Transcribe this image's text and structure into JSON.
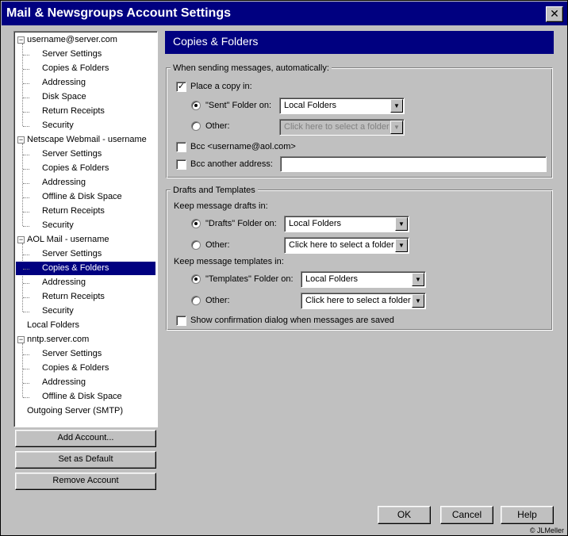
{
  "window": {
    "title": "Mail & Newsgroups Account Settings",
    "close_label": "✕"
  },
  "tree": [
    {
      "label": "username@server.com",
      "level": 0,
      "expander": "−"
    },
    {
      "label": "Server Settings",
      "level": 1
    },
    {
      "label": "Copies & Folders",
      "level": 1
    },
    {
      "label": "Addressing",
      "level": 1
    },
    {
      "label": "Disk Space",
      "level": 1
    },
    {
      "label": "Return Receipts",
      "level": 1
    },
    {
      "label": "Security",
      "level": 1
    },
    {
      "label": "Netscape Webmail - username",
      "level": 0,
      "expander": "−"
    },
    {
      "label": "Server Settings",
      "level": 1
    },
    {
      "label": "Copies & Folders",
      "level": 1
    },
    {
      "label": "Addressing",
      "level": 1
    },
    {
      "label": "Offline & Disk Space",
      "level": 1
    },
    {
      "label": "Return Receipts",
      "level": 1
    },
    {
      "label": "Security",
      "level": 1
    },
    {
      "label": "AOL Mail - username",
      "level": 0,
      "expander": "−"
    },
    {
      "label": "Server Settings",
      "level": 1
    },
    {
      "label": "Copies & Folders",
      "level": 1,
      "selected": true
    },
    {
      "label": "Addressing",
      "level": 1
    },
    {
      "label": "Return Receipts",
      "level": 1
    },
    {
      "label": "Security",
      "level": 1
    },
    {
      "label": "Local Folders",
      "level": 0
    },
    {
      "label": "nntp.server.com",
      "level": 0,
      "expander": "−"
    },
    {
      "label": "Server Settings",
      "level": 1
    },
    {
      "label": "Copies & Folders",
      "level": 1
    },
    {
      "label": "Addressing",
      "level": 1
    },
    {
      "label": "Offline & Disk Space",
      "level": 1
    },
    {
      "label": "Outgoing Server (SMTP)",
      "level": 0
    }
  ],
  "left_buttons": {
    "add": "Add Account...",
    "default": "Set as Default",
    "remove": "Remove Account"
  },
  "panel": {
    "title": "Copies & Folders",
    "sending": {
      "group_title": "When sending messages, automatically:",
      "place_copy": {
        "label": "Place a copy in:",
        "checked": true
      },
      "sent_folder": {
        "label": "\"Sent\" Folder on:",
        "selected": true,
        "value": "Local Folders"
      },
      "other": {
        "label": "Other:",
        "selected": false,
        "value": "Click here to select a folder"
      },
      "bcc_self": {
        "label": "Bcc <username@aol.com>",
        "checked": false
      },
      "bcc_other": {
        "label": "Bcc another address:",
        "checked": false,
        "value": ""
      }
    },
    "drafts": {
      "group_title": "Drafts and Templates",
      "keep_drafts": "Keep message drafts in:",
      "drafts_folder": {
        "label": "\"Drafts\" Folder on:",
        "selected": true,
        "value": "Local Folders"
      },
      "drafts_other": {
        "label": "Other:",
        "selected": false,
        "value": "Click here to select a folder"
      },
      "keep_templates": "Keep message templates in:",
      "templates_folder": {
        "label": "\"Templates\" Folder on:",
        "selected": true,
        "value": "Local Folders"
      },
      "templates_other": {
        "label": "Other:",
        "selected": false,
        "value": "Click here to select a folder"
      },
      "confirm": {
        "label": "Show confirmation dialog when messages are saved",
        "checked": false
      }
    }
  },
  "footer": {
    "ok": "OK",
    "cancel": "Cancel",
    "help": "Help",
    "copyright": "© JLMeller"
  },
  "icons": {
    "check": "✓",
    "dropdown": "▼"
  }
}
